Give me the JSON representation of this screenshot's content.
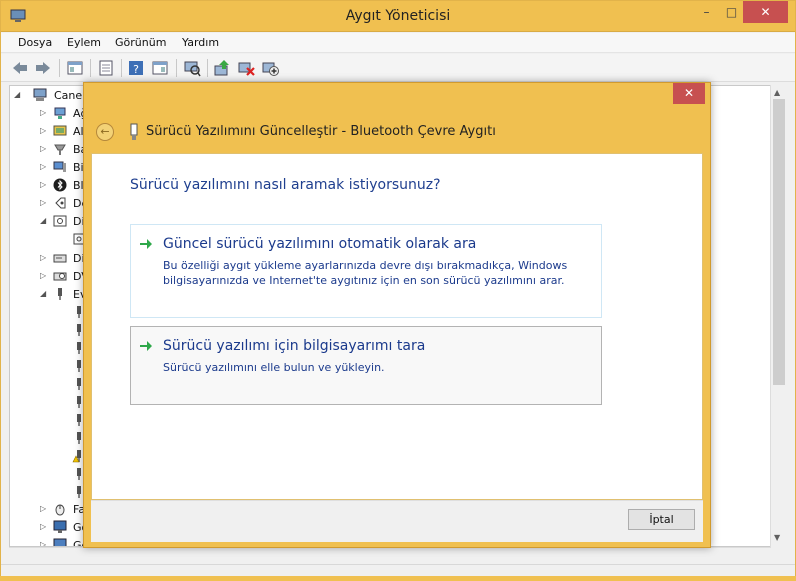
{
  "window": {
    "title": "Aygıt Yöneticisi",
    "minimize": "–",
    "maximize": "□",
    "close": "✕"
  },
  "menu": {
    "items": [
      "Dosya",
      "Eylem",
      "Görünüm",
      "Yardım"
    ]
  },
  "tree": {
    "rows": [
      {
        "label": "Caner",
        "arrow": "◢"
      },
      {
        "label": "Ağ",
        "arrow": "▷"
      },
      {
        "label": "Al",
        "arrow": "▷"
      },
      {
        "label": "Ba",
        "arrow": "▷"
      },
      {
        "label": "Bi",
        "arrow": "▷"
      },
      {
        "label": "Bl",
        "arrow": "▷"
      },
      {
        "label": "De",
        "arrow": "▷"
      },
      {
        "label": "Di",
        "arrow": "◢"
      },
      {
        "label": "",
        "arrow": ""
      },
      {
        "label": "Di",
        "arrow": "▷"
      },
      {
        "label": "DV",
        "arrow": "▷"
      },
      {
        "label": "Ev",
        "arrow": "◢"
      },
      {
        "label": "Fa",
        "arrow": "▷"
      },
      {
        "label": "Gö",
        "arrow": "▷"
      },
      {
        "label": "Gö",
        "arrow": "▷"
      }
    ]
  },
  "dialog": {
    "close": "✕",
    "title": "Sürücü Yazılımını Güncelleştir - Bluetooth Çevre Aygıtı",
    "question": "Sürücü yazılımını nasıl aramak istiyorsunuz?",
    "option1": {
      "title": "Güncel sürücü yazılımını otomatik olarak ara",
      "desc": "Bu özelliği aygıt yükleme ayarlarınızda devre dışı bırakmadıkça, Windows bilgisayarınızda ve Internet'te aygıtınız için en son sürücü yazılımını arar."
    },
    "option2": {
      "title": "Sürücü yazılımı için bilgisayarımı tara",
      "desc": "Sürücü yazılımını elle bulun ve yükleyin."
    },
    "cancel": "İptal"
  },
  "colors": {
    "accent": "#f0c050",
    "link": "#1b3a8c",
    "arrow_green": "#2ea84a"
  },
  "icons": [
    "device-manager-icon",
    "back-arrow-icon",
    "forward-arrow-icon",
    "properties-icon",
    "help-icon",
    "scan-icon",
    "update-driver-icon",
    "uninstall-icon",
    "add-hardware-icon",
    "bluetooth-device-icon",
    "green-arrow-icon"
  ]
}
